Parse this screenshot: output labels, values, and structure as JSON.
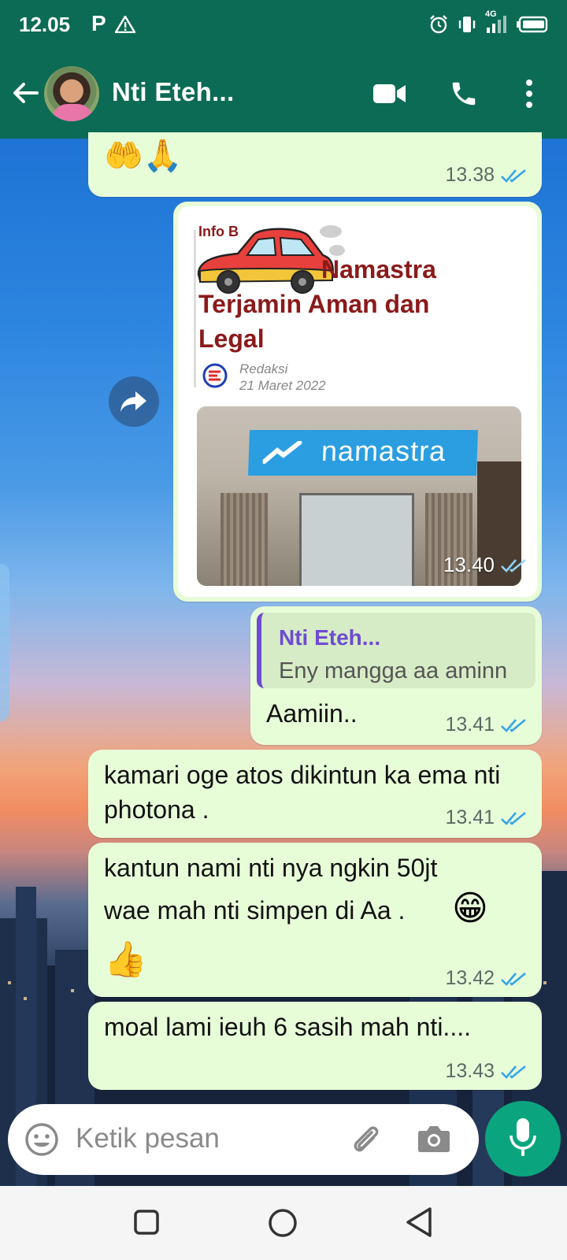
{
  "status_bar": {
    "time": "12.05",
    "p_indicator": "P",
    "network": "4G",
    "icons": [
      "warning-icon",
      "alarm-icon",
      "vibrate-icon",
      "signal-icon",
      "battery-icon"
    ]
  },
  "header": {
    "title": "Nti Eteh...",
    "icons": [
      "back-arrow-icon",
      "video-call-icon",
      "phone-call-icon",
      "more-menu-icon"
    ],
    "color": "#0c6b54"
  },
  "messages": [
    {
      "type": "emoji",
      "text": "🤲🙏",
      "time": "13.38",
      "status": "read"
    },
    {
      "type": "link_preview",
      "preview_label": "Info B",
      "preview_title": "Namastra Terjamin Aman dan Legal",
      "preview_author": "Redaksi",
      "preview_date": "21 Maret 2022",
      "photo_sign": "namastra",
      "time": "13.40",
      "status": "read"
    },
    {
      "type": "reply",
      "quote_name": "Nti Eteh...",
      "quote_text": "Eny mangga aa aminn",
      "text": "Aamiin..",
      "time": "13.41",
      "status": "read"
    },
    {
      "type": "text",
      "text": "kamari oge atos dikintun ka ema nti photona .",
      "time": "13.41",
      "status": "read"
    },
    {
      "type": "text",
      "text": "kantun nami nti nya ngkin 50jt wae mah nti simpen di Aa . 😁 👍",
      "line1": "kantun nami nti nya ngkin 50jt",
      "line2": "wae mah nti simpen di Aa .",
      "emoji_grin": "😁",
      "emoji_thumb": "👍",
      "time": "13.42",
      "status": "read"
    },
    {
      "type": "text",
      "text": "moal lami ieuh 6 sasih mah nti....",
      "time": "13.43",
      "status": "read"
    }
  ],
  "input": {
    "placeholder": "Ketik pesan"
  },
  "colors": {
    "bubble": "#e7fdd8",
    "tick_read": "#34a5e8",
    "mic_button": "#0aa57e"
  }
}
